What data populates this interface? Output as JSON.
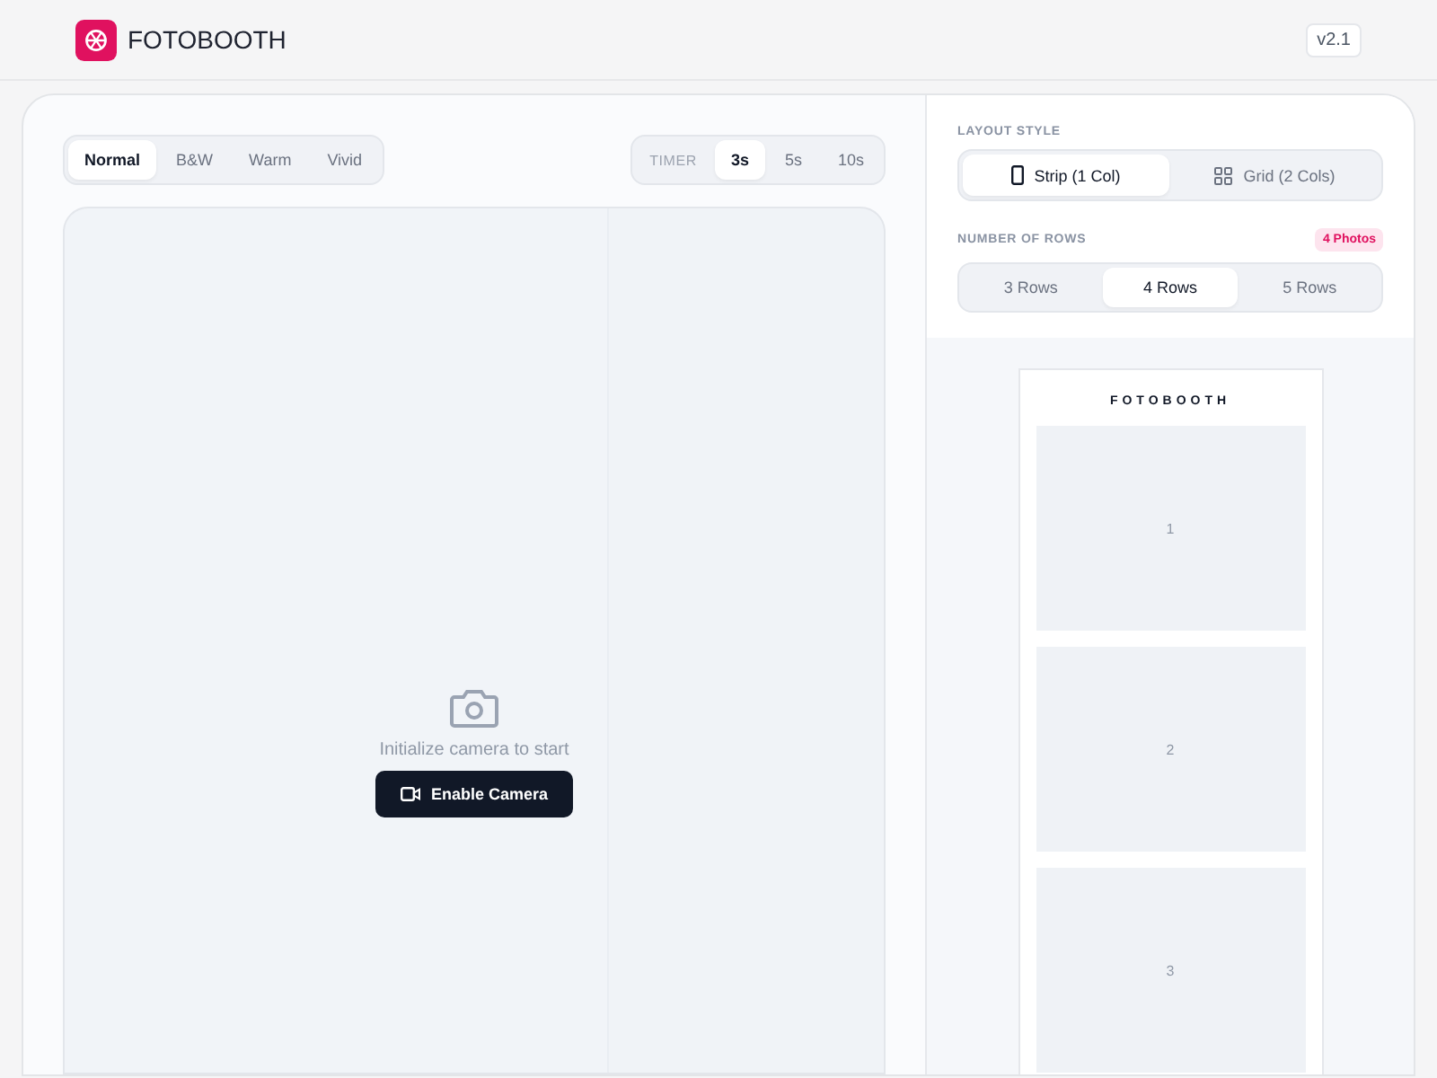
{
  "app": {
    "title": "FOTOBOOTH",
    "version": "v2.1"
  },
  "filters": [
    {
      "label": "Normal",
      "selected": true
    },
    {
      "label": "B&W",
      "selected": false
    },
    {
      "label": "Warm",
      "selected": false
    },
    {
      "label": "Vivid",
      "selected": false
    }
  ],
  "timer": {
    "label": "TIMER",
    "options": [
      {
        "label": "3s",
        "selected": true
      },
      {
        "label": "5s",
        "selected": false
      },
      {
        "label": "10s",
        "selected": false
      }
    ]
  },
  "camera": {
    "message": "Initialize camera to start",
    "button": "Enable Camera"
  },
  "layout_style": {
    "label": "LAYOUT STYLE",
    "options": [
      {
        "kind": "strip",
        "label": "Strip (1 Col)",
        "selected": true
      },
      {
        "kind": "grid",
        "label": "Grid (2 Cols)",
        "selected": false
      }
    ]
  },
  "rows": {
    "label": "NUMBER OF ROWS",
    "badge": "4 Photos",
    "options": [
      {
        "label": "3 Rows",
        "selected": false
      },
      {
        "label": "4 Rows",
        "selected": true
      },
      {
        "label": "5 Rows",
        "selected": false
      }
    ]
  },
  "preview": {
    "title": "FOTOBOOTH",
    "frames": [
      "1",
      "2",
      "3"
    ]
  }
}
